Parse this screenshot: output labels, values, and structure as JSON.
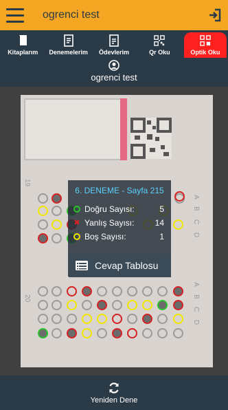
{
  "header": {
    "title": "ogrenci test",
    "menu_icon": "hamburger-icon",
    "logout_icon": "logout-icon"
  },
  "tabs": [
    {
      "label": "Kitaplarım",
      "icon": "book-icon",
      "active": false
    },
    {
      "label": "Denemelerim",
      "icon": "document-icon",
      "active": false
    },
    {
      "label": "Ödevlerim",
      "icon": "homework-icon",
      "active": false
    },
    {
      "label": "Qr Oku",
      "icon": "qr-icon",
      "active": false
    },
    {
      "label": "Optik Oku",
      "icon": "optic-icon",
      "active": true
    }
  ],
  "profile": {
    "name": "ogrenci test",
    "icon": "user-icon"
  },
  "result": {
    "title": "6. DENEME - Sayfa 215",
    "rows": [
      {
        "label": "Doğru Sayısı:",
        "value": "5",
        "marker": "green"
      },
      {
        "label": "Yanlış Sayısı:",
        "value": "14",
        "marker": "red-x"
      },
      {
        "label": "Boş Sayısı:",
        "value": "1",
        "marker": "yellow"
      }
    ],
    "table_button": "Cevap Tablosu"
  },
  "paper": {
    "numbers": [
      "19",
      "20"
    ],
    "letters": [
      "A",
      "B",
      "C",
      "D"
    ]
  },
  "footer": {
    "retry_label": "Yeniden Dene",
    "retry_icon": "refresh-icon"
  },
  "colors": {
    "header_bg": "#f5a623",
    "active_tab": "#ff2020",
    "nav_bg": "#2b3a47",
    "title_accent": "#5ad1ff"
  }
}
